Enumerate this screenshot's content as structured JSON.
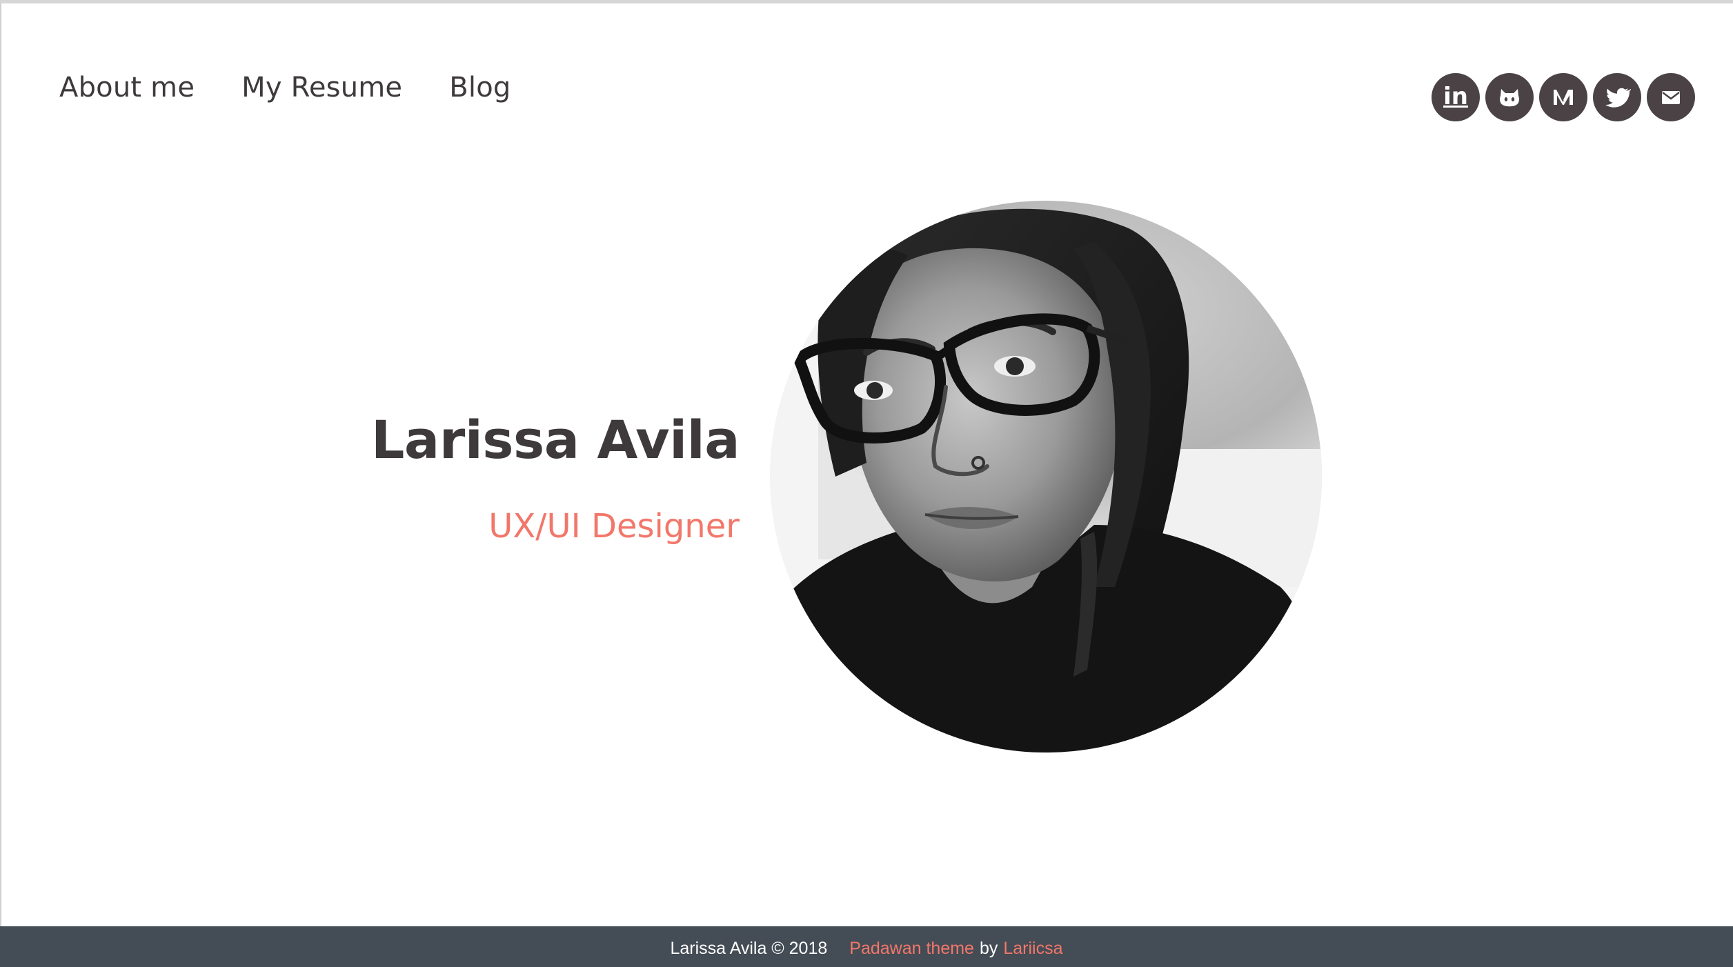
{
  "nav": {
    "items": [
      {
        "label": "About me"
      },
      {
        "label": "My Resume"
      },
      {
        "label": "Blog"
      }
    ]
  },
  "social": {
    "icons": [
      "linkedin-icon",
      "github-icon",
      "medium-icon",
      "twitter-icon",
      "email-icon"
    ],
    "linkedin_glyph": "in"
  },
  "hero": {
    "name": "Larissa Avila",
    "role": "UX/UI Designer"
  },
  "footer": {
    "copyright": "Larissa Avila © 2018",
    "theme_link": "Padawan theme",
    "by": "by",
    "author_link": "Lariicsa"
  },
  "colors": {
    "accent": "#f2776a",
    "text": "#3e3a3c",
    "icon_bg": "#4a4244",
    "footer_bg": "#444c55"
  }
}
